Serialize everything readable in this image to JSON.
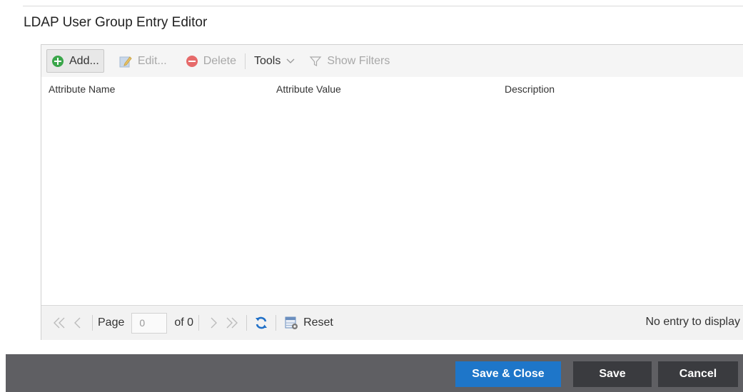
{
  "editor": {
    "title": "LDAP User Group Entry Editor"
  },
  "toolbar": {
    "add_label": "Add...",
    "edit_label": "Edit...",
    "delete_label": "Delete",
    "tools_label": "Tools",
    "show_filters_label": "Show Filters"
  },
  "grid": {
    "columns": [
      "Attribute Name",
      "Attribute Value",
      "Description"
    ],
    "rows": []
  },
  "pager": {
    "page_label": "Page",
    "page_value": "0",
    "of_label": "of 0",
    "reset_label": "Reset",
    "status": "No entry to display"
  },
  "footer": {
    "save_close_label": "Save & Close",
    "save_label": "Save",
    "cancel_label": "Cancel"
  },
  "colors": {
    "primary": "#1e76c9",
    "footer_bg": "#5f5f63",
    "dark_button": "#3a3b3f",
    "add_icon": "#3aa64a",
    "delete_icon": "#e66a6a",
    "refresh_icon": "#1f6fc7"
  },
  "icons": {
    "add": "plus-circle-icon",
    "edit": "pencil-note-icon",
    "delete": "minus-circle-icon",
    "filter": "funnel-icon",
    "refresh": "refresh-icon",
    "reset": "reset-grid-icon"
  }
}
